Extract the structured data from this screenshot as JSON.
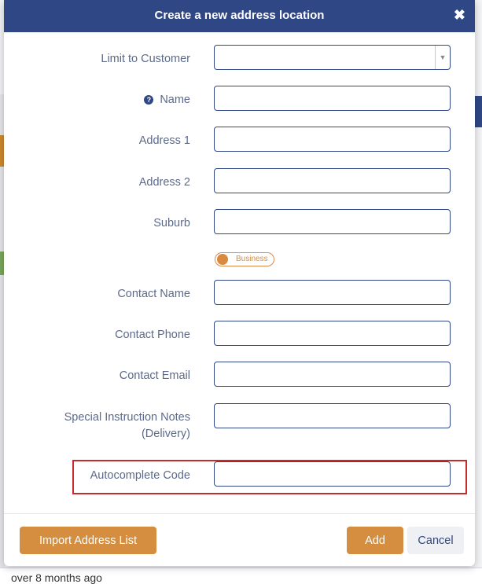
{
  "background": {
    "footer_text": "over 8 months ago"
  },
  "modal": {
    "title": "Create a new address location",
    "close_icon": "close-icon",
    "fields": [
      {
        "key": "limit_to_customer",
        "label": "Limit to Customer",
        "value": "",
        "type": "select"
      },
      {
        "key": "name",
        "label": "Name",
        "value": "",
        "type": "text",
        "help_icon": "question-circle-icon"
      },
      {
        "key": "address_1",
        "label": "Address 1",
        "value": "",
        "type": "text"
      },
      {
        "key": "address_2",
        "label": "Address 2",
        "value": "",
        "type": "text"
      },
      {
        "key": "suburb",
        "label": "Suburb",
        "value": "",
        "type": "text"
      },
      {
        "key": "contact_name",
        "label": "Contact Name",
        "value": "",
        "type": "text"
      },
      {
        "key": "contact_phone",
        "label": "Contact Phone",
        "value": "",
        "type": "text"
      },
      {
        "key": "contact_email",
        "label": "Contact Email",
        "value": "",
        "type": "text"
      },
      {
        "key": "special_instruction_notes",
        "label_line1": "Special Instruction Notes",
        "label_line2": "(Delivery)",
        "value": "",
        "type": "text"
      },
      {
        "key": "autocomplete_code",
        "label": "Autocomplete Code",
        "value": "",
        "type": "text"
      }
    ],
    "toggle": {
      "label": "Business",
      "state": "off"
    },
    "buttons": {
      "import": "Import Address List",
      "add": "Add",
      "cancel": "Cancel"
    }
  },
  "colors": {
    "header": "#2f4784",
    "accent": "#d58d3f",
    "highlight": "#c42b2b",
    "label": "#5c6a8a"
  }
}
